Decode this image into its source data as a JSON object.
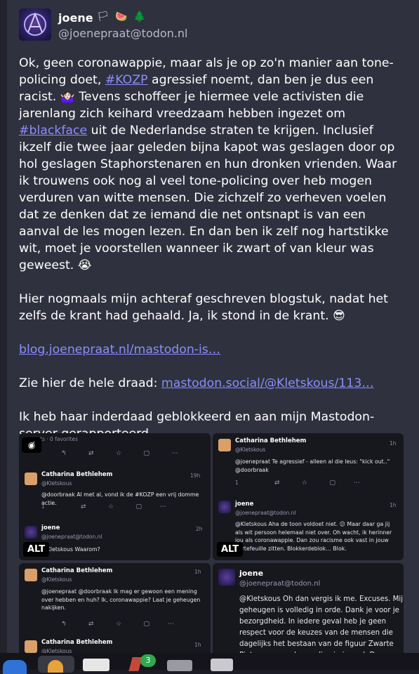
{
  "post": {
    "display_name": "joene",
    "flags": "🏳 🍉 🌲",
    "handle": "@joenepraat@todon.nl",
    "paragraphs": {
      "p1_a": "Ok, geen coronawappie, maar als je op zo'n manier aan tone-policing doet, ",
      "p1_tag1": "#KOZP",
      "p1_b": " agressief noemt, dan ben je dus een racist. ",
      "p1_emoji1": "🤷🏻‍♀️",
      "p1_c": " Tevens schoffeer je hiermee vele activisten die jarenlang zich keihard vreedzaam hebben ingezet om ",
      "p1_tag2": "#blackface",
      "p1_d": " uit de Nederlandse straten te krijgen. Inclusief ikzelf die twee jaar geleden bijna kapot was geslagen door op hol geslagen Staphorstenaren en hun dronken vrienden. Waar ik trouwens ook nog al veel tone-policing over heb mogen verduren van witte mensen. Die zichzelf zo verheven voelen dat ze denken dat ze iemand die net ontsnapt is van een aanval de les mogen lezen. En dan ben ik zelf nog hartstikke wit, moet je voorstellen wanneer ik zwart of van kleur was geweest. ",
      "p1_emoji2": "😭",
      "p2_a": "Hier nogmaals mijn achteraf geschreven blogstuk, nadat het zelfs de krant had gehaald. Ja, ik stond in de krant. ",
      "p2_emoji": "😎",
      "p3_link": "blog.joenepraat.nl/mastodon-is…",
      "p4_a": "Zie hier de hele draad: ",
      "p4_link": "mastodon.social/@Kletskous/113…",
      "p5": "Ik heb haar inderdaad geblokkeerd en aan mijn Mastodon-server gerapporteerd."
    }
  },
  "media": {
    "alt_label": "ALT",
    "hide_icon": "eye-slash-icon",
    "tile1": {
      "top_text": "ts · 0 favorites",
      "reply1_name": "Catharina Bethlehem",
      "reply1_handle": "@Kletskous",
      "reply1_time": "19h",
      "reply1_text": "@doorbraak Al met al, vond ik de #KOZP een vrij domme actie.",
      "reply1_count": "1",
      "reply2_name": "joene",
      "reply2_handle": "@joenepraat@todon.nl",
      "reply2_time": "2h",
      "reply2_text": "@Kletskous Waarom?"
    },
    "tile2": {
      "reply1_name": "Catharina Bethlehem",
      "reply1_handle": "@Kletskous",
      "reply1_time": "1h",
      "reply1_text": "@joenepraat Te agressief - alleen al die leus: \"kick out..\" @doorbraak",
      "reply1_count": "1",
      "reply2_name": "joene",
      "reply2_handle": "@joenepraat@todon.nl",
      "reply2_time": "1h",
      "reply2_text": "@Kletskous Aha de toon voldoet niet. 😕 Maar daar ga jij als wit persoon helemaal niet over. Oh wacht, ik herinner jou als coronawappie. Dan zou racisme ook vast in jouw portefeuille zitten. Blokkerdeblok… Blok."
    },
    "tile3": {
      "reply1_name": "Catharina Bethlehem",
      "reply1_handle": "@Kletskous",
      "reply1_time": "1h",
      "reply1_text": "@joenepraat @doorbraak Ik mag er gewoon een mening over hebben en huh? Ik, coronawappie? Laat je geheugen nakijken.",
      "reply2_name": "Catharina Bethlehem",
      "reply2_handle": "@Kletskous",
      "reply2_time": "1h"
    },
    "tile4": {
      "name": "joene",
      "handle": "@joenepraat@todon.nl",
      "text": "@Kletskous Oh dan vergis ik me. Excuses. Mijn geheugen is volledig in orde. Dank je voor je bezorgdheid. In iedere geval heb je geen respect voor de keuzes van de mensen die dagelijks het bestaan van de figuur Zwarte Piet zwaar worden gediscrimineerd. Dus, alsnog blokkerdeblok."
    }
  },
  "taskbar": {
    "badge_count": "3"
  }
}
